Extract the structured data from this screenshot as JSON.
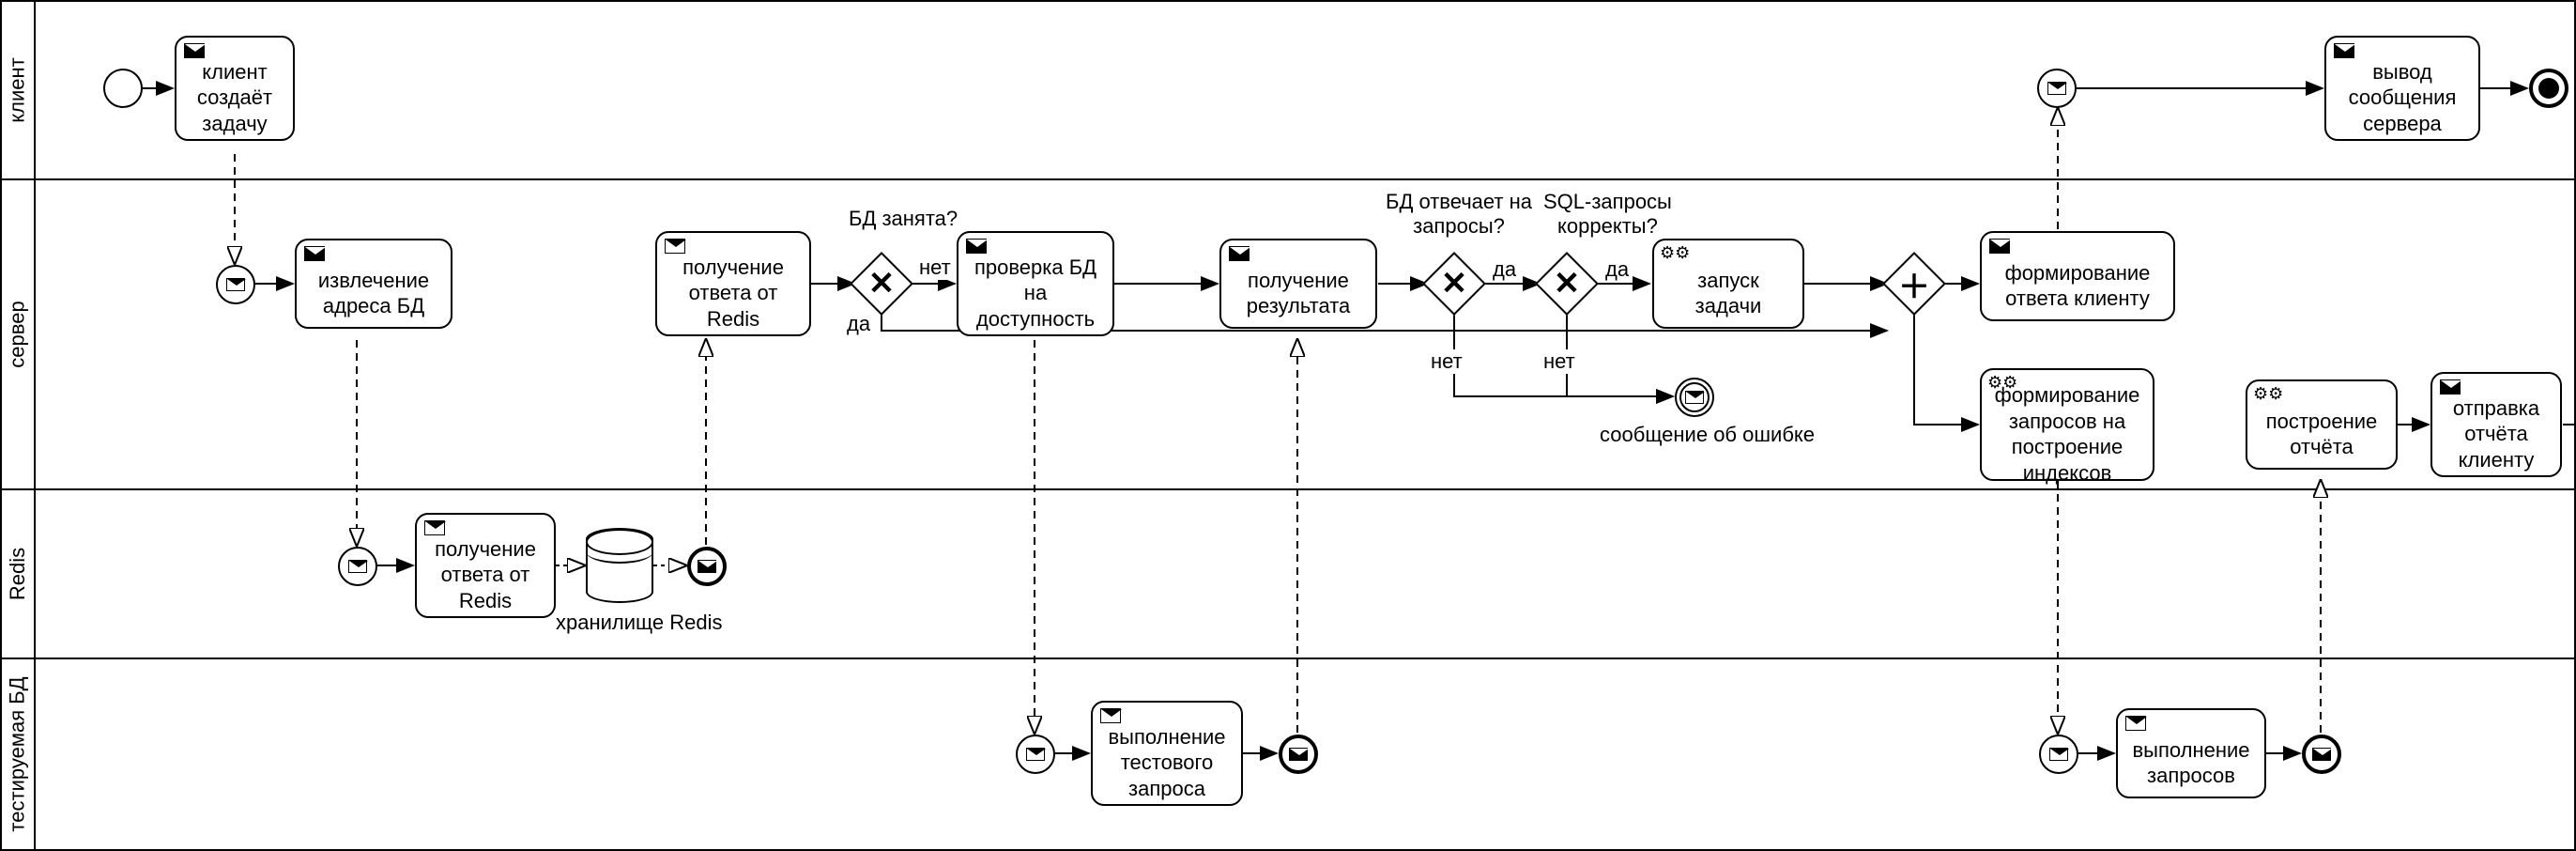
{
  "lanes": {
    "client": "клиент",
    "server": "сервер",
    "redis": "Redis",
    "db": "тестируемая БД"
  },
  "tasks": {
    "client_create": "клиент\nсоздаёт\nзадачу",
    "output_msg": "вывод\nсообщения\nсервера",
    "extract_addr": "извлечение\nадреса БД",
    "get_redis_reply_srv": "получение\nответа от\nRedis",
    "check_db": "проверка БД\nна\nдоступность",
    "get_result": "получение\nрезультата",
    "start_task": "запуск\nзадачи",
    "form_reply": "формирование\nответа клиенту",
    "form_idx_queries": "формирование\nзапросов на\nпостроение\nиндексов",
    "build_report": "построение\nотчёта",
    "send_report": "отправка\nотчёта\nклиенту",
    "get_redis_reply": "получение\nответа от\nRedis",
    "exec_test_query": "выполнение\nтестового\nзапроса",
    "exec_queries": "выполнение\nзапросов"
  },
  "labels": {
    "db_busy": "БД занята?",
    "yes": "да",
    "no": "нет",
    "db_responds": "БД отвечает на\nзапросы?",
    "sql_correct": "SQL-запросы\nкорректы?",
    "error_msg": "сообщение об ошибке",
    "redis_store": "хранилище Redis"
  }
}
